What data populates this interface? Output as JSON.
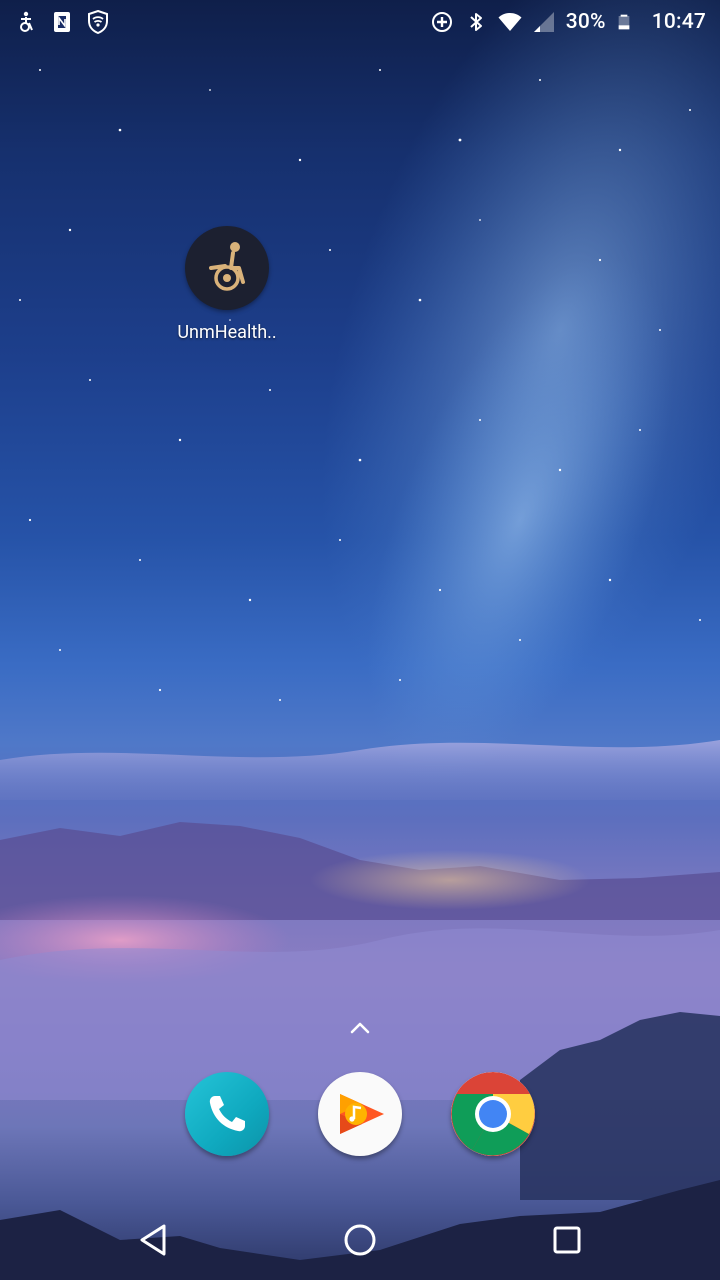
{
  "status_bar": {
    "left_icons": [
      "accessibility-icon",
      "nfc-icon",
      "vpn-shield-icon"
    ],
    "right_icons": [
      "data-saver-icon",
      "bluetooth-icon",
      "wifi-icon",
      "cell-signal-icon",
      "battery-icon"
    ],
    "battery_percent": "30%",
    "battery_level": 0.3,
    "time": "10:47"
  },
  "desktop": {
    "apps": [
      {
        "label": "UnmHealth..",
        "icon": "wheelchair-icon",
        "icon_bg": "#1c2030",
        "icon_fg": "#d9b27a"
      }
    ]
  },
  "drawer": {
    "icon": "chevron-up-icon"
  },
  "dock": {
    "apps": [
      {
        "name": "Phone",
        "icon": "phone-icon",
        "color": "#12b3c9"
      },
      {
        "name": "Play Music",
        "icon": "play-music-icon",
        "color": "#ff5722"
      },
      {
        "name": "Chrome",
        "icon": "chrome-icon",
        "color": "#4285f4"
      }
    ]
  },
  "nav_bar": {
    "icons": [
      "back-icon",
      "home-icon",
      "recents-icon"
    ]
  }
}
